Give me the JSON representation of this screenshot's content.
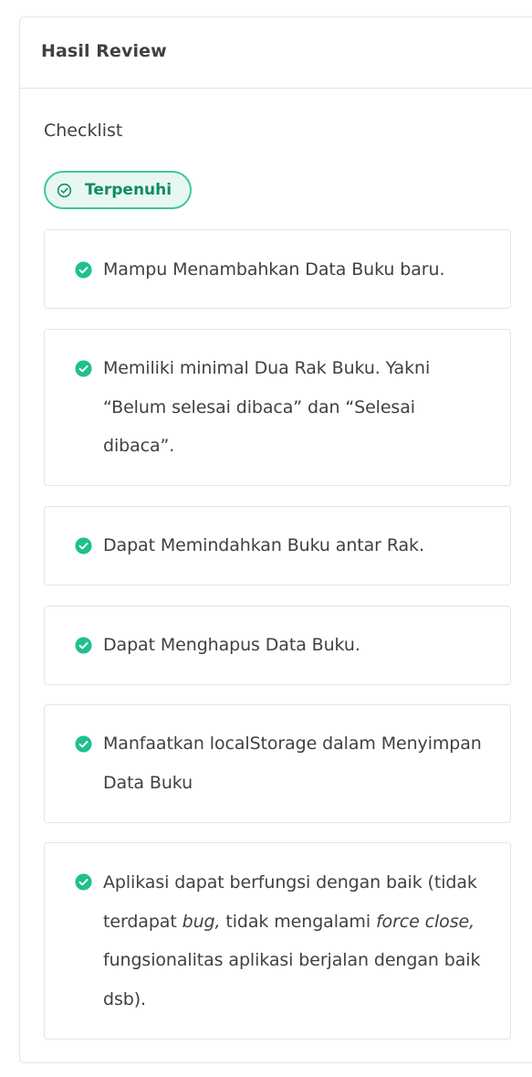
{
  "card": {
    "title": "Hasil Review"
  },
  "checklist": {
    "title": "Checklist",
    "status_badge": {
      "label": "Terpenuhi",
      "icon": "check-circle-outline-icon",
      "color": "#0f8c63",
      "border_color": "#3cc89c",
      "background": "#e8f8f1"
    },
    "check_icon": "check-circle-filled-icon",
    "check_color": "#1fbf8f",
    "items": [
      {
        "text": "Mampu Menambahkan Data Buku baru."
      },
      {
        "text": "Memiliki minimal Dua Rak Buku. Yakni “Belum selesai dibaca” dan “Selesai dibaca”."
      },
      {
        "text": "Dapat Memindahkan Buku antar Rak."
      },
      {
        "text": "Dapat Menghapus Data Buku."
      },
      {
        "text": "Manfaatkan localStorage dalam Menyimpan Data Buku"
      },
      {
        "parts": [
          "Aplikasi dapat berfungsi dengan baik (tidak terdapat ",
          "bug,",
          " tidak mengalami ",
          "force close,",
          " fungsionalitas aplikasi berjalan dengan baik dsb)."
        ]
      }
    ]
  }
}
